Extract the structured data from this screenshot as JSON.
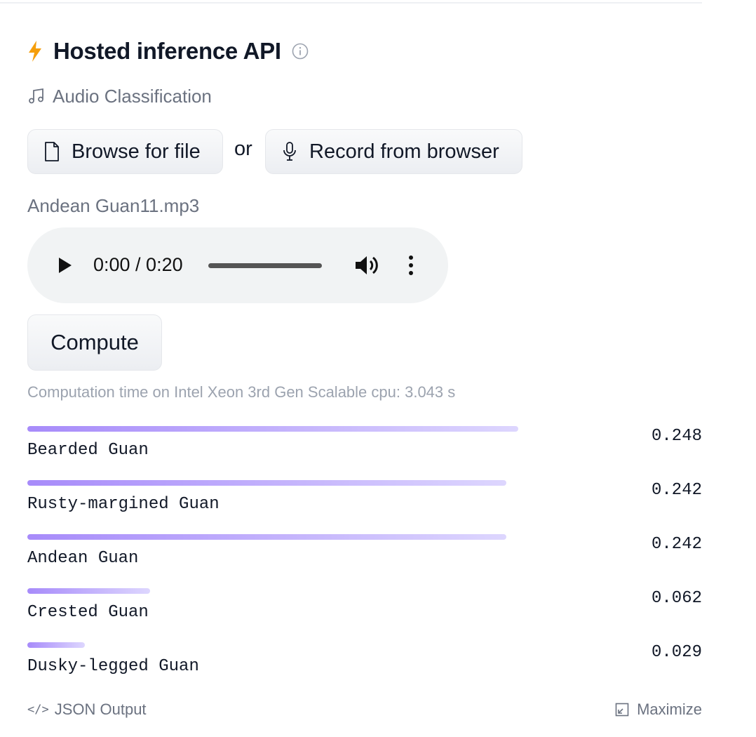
{
  "header": {
    "title": "Hosted inference API",
    "bolt_icon": "bolt-icon",
    "info_icon": "info-icon",
    "accent_color": "#f59e0b"
  },
  "task": {
    "label": "Audio Classification",
    "icon": "music-note-icon"
  },
  "upload": {
    "browse_label": "Browse for file",
    "or_label": "or",
    "record_label": "Record from browser"
  },
  "file": {
    "name": "Andean Guan11.mp3"
  },
  "audio_player": {
    "time": "0:00 / 0:20",
    "progress": 0
  },
  "compute": {
    "button_label": "Compute",
    "time_text": "Computation time on Intel Xeon 3rd Gen Scalable cpu: 3.043 s"
  },
  "results": [
    {
      "label": "Bearded Guan",
      "score": "0.248",
      "value": 0.248
    },
    {
      "label": "Rusty-margined Guan",
      "score": "0.242",
      "value": 0.242
    },
    {
      "label": "Andean Guan",
      "score": "0.242",
      "value": 0.242
    },
    {
      "label": "Crested Guan",
      "score": "0.062",
      "value": 0.062
    },
    {
      "label": "Dusky-legged Guan",
      "score": "0.029",
      "value": 0.029
    }
  ],
  "bar_colors": {
    "start": "#a78bfa",
    "end": "#ddd6fe"
  },
  "footer": {
    "json_label": "JSON Output",
    "maximize_label": "Maximize"
  }
}
